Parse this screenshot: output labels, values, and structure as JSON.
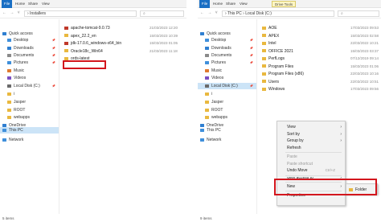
{
  "left": {
    "tabs": [
      "File",
      "Home",
      "Share",
      "View"
    ],
    "nav_arrows": "← → ˅ ↑",
    "address": "› Installers",
    "nav": [
      {
        "label": "Quick access",
        "icon": "star-icon",
        "color": "#2f7fd1",
        "pinned": false
      },
      {
        "label": "Desktop",
        "icon": "desktop-icon",
        "color": "#3f8fdb",
        "pinned": true
      },
      {
        "label": "Downloads",
        "icon": "download-icon",
        "color": "#2f7fd1",
        "pinned": true
      },
      {
        "label": "Documents",
        "icon": "document-icon",
        "color": "#8a8a8a",
        "pinned": true
      },
      {
        "label": "Pictures",
        "icon": "picture-icon",
        "color": "#3f8fdb",
        "pinned": true
      },
      {
        "label": "Music",
        "icon": "music-icon",
        "color": "#e07a2f",
        "pinned": false
      },
      {
        "label": "Videos",
        "icon": "video-icon",
        "color": "#7a4fc2",
        "pinned": false
      },
      {
        "label": "Local Disk (C:)",
        "icon": "drive-icon",
        "color": "#6a6a6a",
        "pinned": true
      },
      {
        "label": "i",
        "icon": "folder-icon",
        "color": "#e9b83f",
        "pinned": false
      },
      {
        "label": "Jasper",
        "icon": "folder-icon",
        "color": "#e9b83f",
        "pinned": false
      },
      {
        "label": "ROOT",
        "icon": "folder-icon",
        "color": "#e9b83f",
        "pinned": false
      },
      {
        "label": "webapps",
        "icon": "folder-icon",
        "color": "#e9b83f",
        "pinned": false
      },
      {
        "label": "OneDrive",
        "icon": "cloud-icon",
        "color": "#2f7fd1",
        "pinned": false
      },
      {
        "label": "This PC",
        "icon": "pc-icon",
        "color": "#3f8fdb",
        "pinned": false,
        "selected": true
      },
      {
        "label": "Network",
        "icon": "network-icon",
        "color": "#3f8fdb",
        "pinned": false
      }
    ],
    "files": [
      {
        "name": "apache-tomcat-9.0.73",
        "date": "21/03/2023 12:20",
        "color": "#c0392b"
      },
      {
        "name": "apex_22.2_en",
        "date": "15/03/2023 10:39",
        "color": "#e9b83f"
      },
      {
        "name": "jdk-17.0.6_windows-x64_bin",
        "date": "15/03/2023 01:05",
        "color": "#c0392b"
      },
      {
        "name": "Oracle18c_Win64",
        "date": "21/03/2023 11:18",
        "color": "#e9b83f"
      },
      {
        "name": "ords-latest",
        "date": "",
        "color": "#e9b83f"
      }
    ],
    "status": "5 items"
  },
  "right": {
    "tabs": [
      "File",
      "Home",
      "Share",
      "View"
    ],
    "tools_tab": "Drive Tools",
    "nav_arrows": "← → ˅ ↑",
    "address": "› This PC › Local Disk (C:)",
    "nav": [
      {
        "label": "Quick access",
        "icon": "star-icon",
        "color": "#2f7fd1",
        "pinned": false
      },
      {
        "label": "Desktop",
        "icon": "desktop-icon",
        "color": "#3f8fdb",
        "pinned": true
      },
      {
        "label": "Downloads",
        "icon": "download-icon",
        "color": "#2f7fd1",
        "pinned": true
      },
      {
        "label": "Documents",
        "icon": "document-icon",
        "color": "#8a8a8a",
        "pinned": true
      },
      {
        "label": "Pictures",
        "icon": "picture-icon",
        "color": "#3f8fdb",
        "pinned": true
      },
      {
        "label": "Music",
        "icon": "music-icon",
        "color": "#e07a2f",
        "pinned": false
      },
      {
        "label": "Videos",
        "icon": "video-icon",
        "color": "#7a4fc2",
        "pinned": false
      },
      {
        "label": "Local Disk (C:)",
        "icon": "drive-icon",
        "color": "#6a6a6a",
        "pinned": true,
        "selected": true
      },
      {
        "label": "i",
        "icon": "folder-icon",
        "color": "#e9b83f",
        "pinned": false
      },
      {
        "label": "Jasper",
        "icon": "folder-icon",
        "color": "#e9b83f",
        "pinned": false
      },
      {
        "label": "ROOT",
        "icon": "folder-icon",
        "color": "#e9b83f",
        "pinned": false
      },
      {
        "label": "webapps",
        "icon": "folder-icon",
        "color": "#e9b83f",
        "pinned": false
      },
      {
        "label": "OneDrive",
        "icon": "cloud-icon",
        "color": "#2f7fd1",
        "pinned": false
      },
      {
        "label": "This PC",
        "icon": "pc-icon",
        "color": "#3f8fdb",
        "pinned": false
      },
      {
        "label": "Network",
        "icon": "network-icon",
        "color": "#3f8fdb",
        "pinned": false
      }
    ],
    "files": [
      {
        "name": "AOE",
        "date": "17/03/2023 09:53"
      },
      {
        "name": "APEX",
        "date": "15/03/2023 02:58"
      },
      {
        "name": "Intel",
        "date": "22/03/2022 10:21"
      },
      {
        "name": "OFFICE 2021",
        "date": "15/03/2023 03:37"
      },
      {
        "name": "PerfLogs",
        "date": "07/12/2019 09:14"
      },
      {
        "name": "Program Files",
        "date": "15/03/2023 01:06"
      },
      {
        "name": "Program Files (x86)",
        "date": "22/03/2023 10:16"
      },
      {
        "name": "Users",
        "date": "22/03/2022 10:51"
      },
      {
        "name": "Windows",
        "date": "17/03/2023 09:56"
      }
    ],
    "status": "9 items"
  },
  "context_menu": {
    "items": [
      {
        "label": "View",
        "submenu": true
      },
      {
        "label": "Sort by",
        "submenu": true
      },
      {
        "label": "Group by",
        "submenu": true
      },
      {
        "label": "Refresh"
      },
      {
        "sep": true
      },
      {
        "label": "Paste",
        "disabled": true
      },
      {
        "label": "Paste shortcut",
        "disabled": true
      },
      {
        "label": "Undo Move",
        "shortcut": "Ctrl+Z"
      },
      {
        "sep": true
      },
      {
        "label": "Give access to",
        "submenu": true,
        "partial": true
      },
      {
        "sep": true
      },
      {
        "label": "New",
        "submenu": true
      },
      {
        "sep": true
      },
      {
        "label": "Properties"
      }
    ]
  },
  "submenu": {
    "items": [
      {
        "label": "Folder",
        "icon": "folder-icon",
        "color": "#e9b83f"
      }
    ]
  },
  "colors": {
    "highlight": "#d3161d",
    "file_tab": "#1a6fc4",
    "selection": "#cce4f7"
  }
}
